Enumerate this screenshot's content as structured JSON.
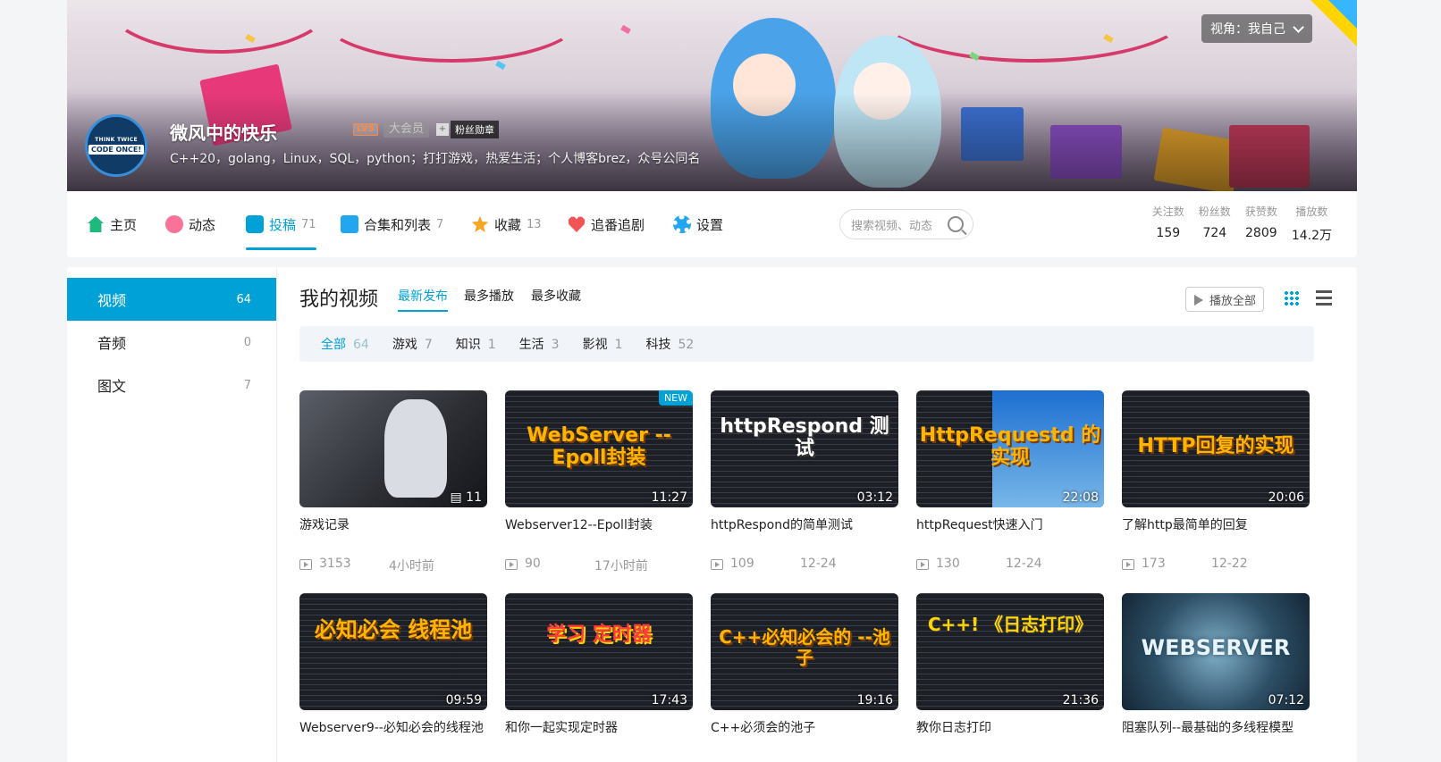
{
  "header": {
    "view_toggle": "视角：我自己",
    "username": "微风中的快乐",
    "level": "LV5",
    "vip": "大会员",
    "fan_medal": "粉丝勋章",
    "bio": "C++20，golang，Linux，SQL，python；打打游戏，热爱生活；个人博客brez，众号公同名",
    "avatar_text_1": "THINK TWICE",
    "avatar_text_2": "CODE ONCE!"
  },
  "nav": {
    "items": [
      {
        "label": "主页",
        "icon": "home-icon",
        "count": ""
      },
      {
        "label": "动态",
        "icon": "dynamic-icon",
        "count": ""
      },
      {
        "label": "投稿",
        "icon": "upload-icon",
        "count": "71"
      },
      {
        "label": "合集和列表",
        "icon": "collection-icon",
        "count": "7"
      },
      {
        "label": "收藏",
        "icon": "star-icon",
        "count": "13"
      },
      {
        "label": "追番追剧",
        "icon": "heart-icon",
        "count": ""
      },
      {
        "label": "设置",
        "icon": "gear-icon",
        "count": ""
      }
    ],
    "search_placeholder": "搜索视频、动态",
    "stats": [
      {
        "label": "关注数",
        "value": "159"
      },
      {
        "label": "粉丝数",
        "value": "724"
      },
      {
        "label": "获赞数",
        "value": "2809"
      },
      {
        "label": "播放数",
        "value": "14.2万"
      }
    ]
  },
  "sidebar": {
    "items": [
      {
        "label": "视频",
        "count": "64"
      },
      {
        "label": "音频",
        "count": "0"
      },
      {
        "label": "图文",
        "count": "7"
      }
    ]
  },
  "main": {
    "title": "我的视频",
    "sort_tabs": [
      "最新发布",
      "最多播放",
      "最多收藏"
    ],
    "play_all": "播放全部",
    "categories": [
      {
        "label": "全部",
        "count": "64"
      },
      {
        "label": "游戏",
        "count": "7"
      },
      {
        "label": "知识",
        "count": "1"
      },
      {
        "label": "生活",
        "count": "3"
      },
      {
        "label": "影视",
        "count": "1"
      },
      {
        "label": "科技",
        "count": "52"
      }
    ],
    "videos": [
      {
        "title": "游戏记录",
        "duration": "11",
        "plays": "3153",
        "date": "4小时前",
        "thumb_text": "",
        "tag": ""
      },
      {
        "title": "Webserver12--Epoll封装",
        "duration": "11:27",
        "plays": "90",
        "date": "17小时前",
        "thumb_text": "WebServer --Epoll封装",
        "tag": "NEW"
      },
      {
        "title": "httpRespond的简单测试",
        "duration": "03:12",
        "plays": "109",
        "date": "12-24",
        "thumb_text": "httpRespond 测试",
        "tag": ""
      },
      {
        "title": "httpRequest快速入门",
        "duration": "22:08",
        "plays": "130",
        "date": "12-24",
        "thumb_text": "HttpRequestd 的实现",
        "tag": ""
      },
      {
        "title": "了解http最简单的回复",
        "duration": "20:06",
        "plays": "173",
        "date": "12-22",
        "thumb_text": "HTTP回复的实现",
        "tag": ""
      },
      {
        "title": "Webserver9--必知必会的线程池",
        "duration": "09:59",
        "plays": "",
        "date": "",
        "thumb_text": "必知必会 线程池",
        "tag": ""
      },
      {
        "title": "和你一起实现定时器",
        "duration": "17:43",
        "plays": "",
        "date": "",
        "thumb_text": "学习 定时器",
        "tag": ""
      },
      {
        "title": "C++必须会的池子",
        "duration": "19:16",
        "plays": "",
        "date": "",
        "thumb_text": "C++必知必会的 --池子",
        "tag": ""
      },
      {
        "title": "教你日志打印",
        "duration": "21:36",
        "plays": "",
        "date": "",
        "thumb_text": "C++! 《日志打印》",
        "tag": ""
      },
      {
        "title": "阻塞队列--最基础的多线程模型",
        "duration": "07:12",
        "plays": "",
        "date": "",
        "thumb_text": "WEBSERVER",
        "tag": ""
      }
    ]
  }
}
